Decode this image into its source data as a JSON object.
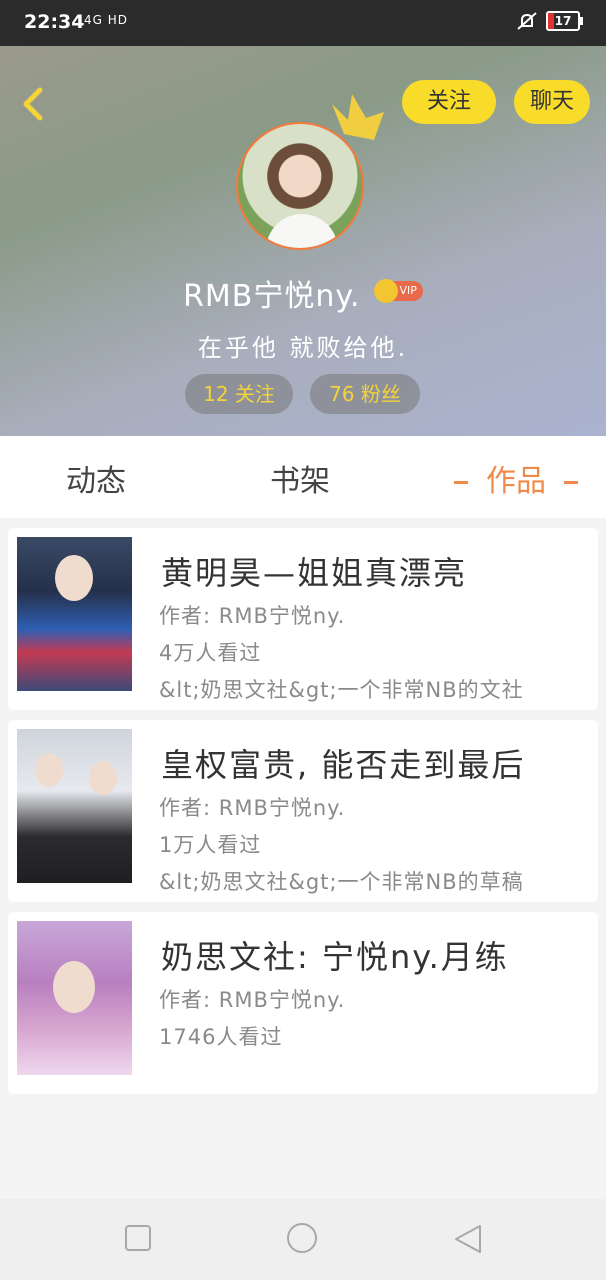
{
  "status_bar": {
    "time": "22:34",
    "network": "4G HD",
    "battery": "17",
    "colors": {
      "battery_low": "#e03232"
    }
  },
  "header": {
    "back_icon": "chevron-left-icon",
    "follow_label": "关注",
    "chat_label": "聊天",
    "username": "RMB宁悦ny.",
    "vip_label": "VIP",
    "bio": "在乎他  就败给他.",
    "follow_count": "12 关注",
    "fans_count": "76 粉丝",
    "colors": {
      "button_yellow": "#f9dc2a",
      "stat_text": "#f4d33a",
      "avatar_ring": "#f47a3c"
    }
  },
  "tabs": [
    {
      "label": "动态",
      "active": false
    },
    {
      "label": "书架",
      "active": false
    },
    {
      "label": "作品",
      "active": true
    }
  ],
  "accent_color": "#f08a4a",
  "works": [
    {
      "title": "黄明昊—姐姐真漂亮",
      "author": "作者: RMB宁悦ny.",
      "views": "4万人看过",
      "desc": "&lt;奶思文社&gt;一个非常NB的文社"
    },
    {
      "title": "皇权富贵, 能否走到最后",
      "author": "作者: RMB宁悦ny.",
      "views": "1万人看过",
      "desc": "&lt;奶思文社&gt;一个非常NB的草稿"
    },
    {
      "title": "奶思文社: 宁悦ny.月练",
      "author": "作者: RMB宁悦ny.",
      "views": "1746人看过",
      "desc": ""
    }
  ],
  "nav_bar": {
    "icons": [
      "square-icon",
      "circle-icon",
      "triangle-back-icon"
    ]
  }
}
